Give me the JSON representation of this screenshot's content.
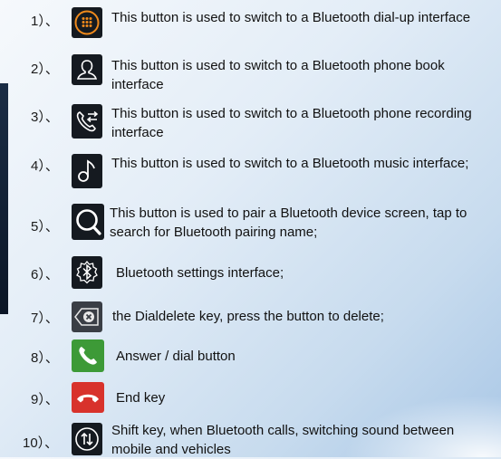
{
  "items": [
    {
      "num": "1）、",
      "icon": "dialpad-icon",
      "text": "This button is used to switch to a Bluetooth dial-up interface"
    },
    {
      "num": "2）、",
      "icon": "contact-icon",
      "text": "This button is used to switch to a Bluetooth phone book interface"
    },
    {
      "num": "3）、",
      "icon": "call-log-icon",
      "text": "This button is used to switch to a Bluetooth phone recording interface"
    },
    {
      "num": "4）、",
      "icon": "music-note-icon",
      "text": "This button is used to switch to a Bluetooth music interface;"
    },
    {
      "num": "5）、",
      "icon": "search-icon",
      "text": "This button is used to pair a Bluetooth device screen, tap to search for Bluetooth pairing name;"
    },
    {
      "num": "6）、",
      "icon": "bluetooth-gear-icon",
      "text": "Bluetooth settings interface;"
    },
    {
      "num": "7）、",
      "icon": "backspace-icon",
      "text": "the Dialdelete key, press the button to delete;"
    },
    {
      "num": "8）、",
      "icon": "answer-call-icon",
      "text": "Answer / dial button"
    },
    {
      "num": "9）、",
      "icon": "end-call-icon",
      "text": "End key"
    },
    {
      "num": "10）、",
      "icon": "swap-audio-icon",
      "text": "Shift key, when Bluetooth calls, switching sound between mobile and vehicles"
    }
  ],
  "colors": {
    "dialpad_orange": "#f08a1c",
    "answer_green": "#3d9a37",
    "end_red": "#d8322c",
    "icon_dark": "#151a20"
  }
}
